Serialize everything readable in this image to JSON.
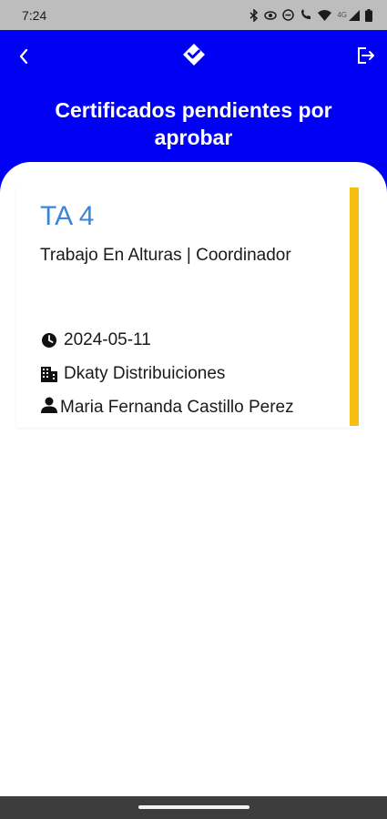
{
  "status_bar": {
    "time": "7:24",
    "network_label": "4G",
    "icons": [
      "bluetooth-icon",
      "eye-icon",
      "do-not-disturb-icon",
      "volte-icon",
      "wifi-icon",
      "signal-icon",
      "battery-icon"
    ]
  },
  "app_bar": {
    "background_color": "#0000f5",
    "back_icon": "chevron-left-icon",
    "logo_icon": "diamond-check-logo",
    "logout_icon": "logout-icon"
  },
  "page": {
    "title": "Certificados pendientes por aprobar"
  },
  "certificates": [
    {
      "code": "TA 4",
      "course": "Trabajo En Alturas | Coordinador",
      "date": "2024-05-11",
      "company": "Dkaty Distribuiciones",
      "person": "Maria Fernanda Castillo Perez",
      "accent_color": "#f5bf0f"
    }
  ]
}
